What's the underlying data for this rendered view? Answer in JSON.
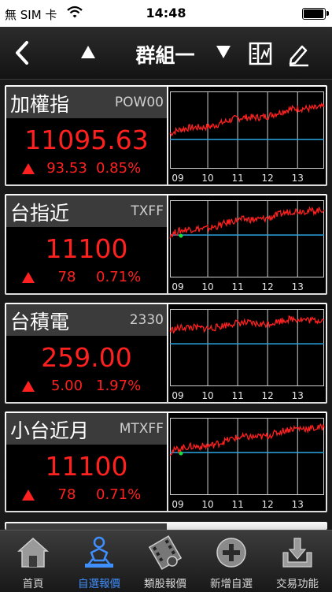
{
  "status_bar": {
    "carrier": "無 SIM 卡",
    "time": "14:48",
    "battery_level": 0.95
  },
  "nav": {
    "title": "群組一",
    "back_icon": "chevron-left-icon",
    "prev_icon": "triangle-up-icon",
    "next_icon": "triangle-down-icon",
    "list_icon": "list-icon",
    "edit_icon": "pencil-icon"
  },
  "colors": {
    "up": "#ff2020",
    "reference_line": "#2aa5e0",
    "active_tab": "#3f8fff"
  },
  "quotes": [
    {
      "name": "加權指",
      "code": "POW00",
      "price": "11095.63",
      "change": "93.53",
      "change_pct": "0.85%",
      "direction": "up",
      "chart": {
        "hours": [
          "09",
          "10",
          "11",
          "12",
          "13"
        ],
        "reference_level": 0.38,
        "start_level": 0.45,
        "end_level": 0.82,
        "opening_dot": false
      }
    },
    {
      "name": "台指近",
      "code": "TXFF",
      "price": "11100",
      "change": "78",
      "change_pct": "0.71%",
      "direction": "up",
      "chart": {
        "hours": [
          "09",
          "10",
          "11",
          "12",
          "13"
        ],
        "reference_level": 0.55,
        "start_level": 0.55,
        "end_level": 0.9,
        "opening_dot": true
      }
    },
    {
      "name": "台積電",
      "code": "2330",
      "price": "259.00",
      "change": "5.00",
      "change_pct": "1.97%",
      "direction": "up",
      "chart": {
        "hours": [
          "09",
          "10",
          "11",
          "12",
          "13"
        ],
        "reference_level": 0.55,
        "start_level": 0.72,
        "end_level": 0.88,
        "opening_dot": false
      }
    },
    {
      "name": "小台近月",
      "code": "MTXFF",
      "price": "11100",
      "change": "78",
      "change_pct": "0.71%",
      "direction": "up",
      "chart": {
        "hours": [
          "09",
          "10",
          "11",
          "12",
          "13"
        ],
        "reference_level": 0.55,
        "start_level": 0.55,
        "end_level": 0.9,
        "opening_dot": true
      }
    }
  ],
  "tabs": [
    {
      "label": "首頁",
      "icon": "home-icon",
      "active": false
    },
    {
      "label": "自選報價",
      "icon": "watchlist-person-icon",
      "active": true
    },
    {
      "label": "類股報價",
      "icon": "film-category-icon",
      "active": false
    },
    {
      "label": "新增自選",
      "icon": "add-circle-icon",
      "active": false
    },
    {
      "label": "交易功能",
      "icon": "trade-download-icon",
      "active": false
    }
  ]
}
